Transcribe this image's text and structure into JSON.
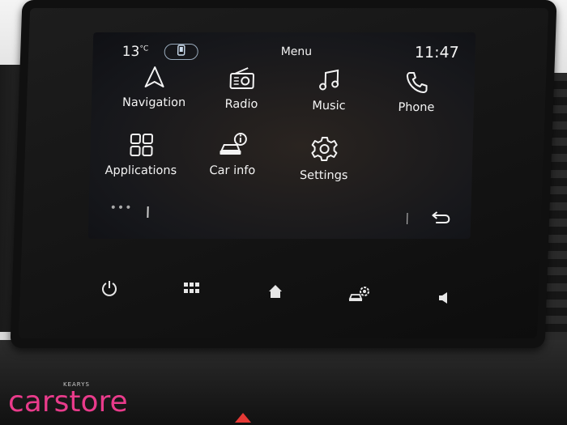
{
  "status": {
    "temperature": "13",
    "temperature_unit": "°C",
    "menu_title": "Menu",
    "clock": "11:47"
  },
  "apps": [
    {
      "label": "Navigation",
      "icon": "navigation-arrow-icon"
    },
    {
      "label": "Radio",
      "icon": "radio-icon"
    },
    {
      "label": "Music",
      "icon": "music-note-icon"
    },
    {
      "label": "Phone",
      "icon": "phone-handset-icon"
    },
    {
      "label": "Applications",
      "icon": "apps-grid-icon"
    },
    {
      "label": "Car info",
      "icon": "car-info-icon"
    },
    {
      "label": "Settings",
      "icon": "gear-icon"
    }
  ],
  "footer": {
    "dots": "•••"
  },
  "hardware_buttons": [
    {
      "icon": "power-icon"
    },
    {
      "icon": "grid-icon"
    },
    {
      "icon": "home-icon"
    },
    {
      "icon": "car-settings-icon"
    },
    {
      "icon": "volume-icon"
    }
  ],
  "branding": {
    "logo": "carstore",
    "tagline": "KEARYS"
  },
  "colors": {
    "screen_text": "#f3f3f3",
    "logo": "#e93b8b"
  }
}
